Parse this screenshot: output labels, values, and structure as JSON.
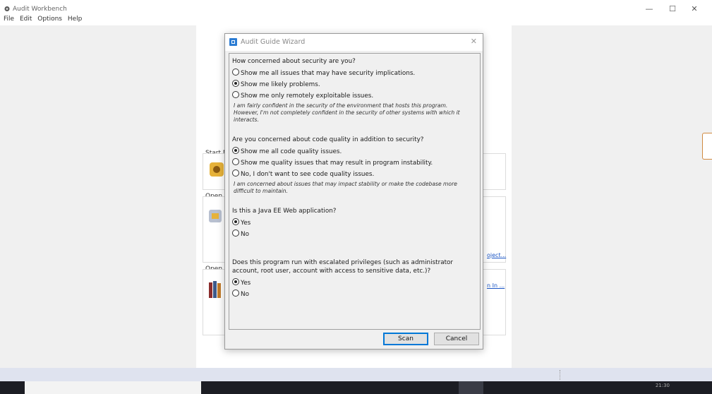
{
  "app": {
    "title": "Audit Workbench"
  },
  "window_controls": {
    "minimize": "—",
    "maximize": "☐",
    "close": "✕"
  },
  "menu": [
    "File",
    "Edit",
    "Options",
    "Help"
  ],
  "background": {
    "start_label": "Start N",
    "open_label_1": "Open",
    "open_label_2": "Open",
    "link_1": "oject...",
    "link_2": "n In ..."
  },
  "dialog": {
    "title": "Audit Guide Wizard",
    "close": "✕",
    "q1": {
      "question": "How concerned about security are you?",
      "options": [
        {
          "label": "Show me all issues that may have security implications.",
          "selected": false
        },
        {
          "label": "Show me likely problems.",
          "selected": true
        },
        {
          "label": "Show me only remotely exploitable issues.",
          "selected": false
        }
      ],
      "description": "I am fairly confident in the security of the environment that hosts this program. However, I'm not completely confident in the security of other systems with which it interacts."
    },
    "q2": {
      "question": "Are you concerned about code quality in addition to security?",
      "options": [
        {
          "label": "Show me all code quality issues.",
          "selected": true
        },
        {
          "label": "Show me quality issues that may result in program instability.",
          "selected": false
        },
        {
          "label": "No, I don't want to see code quality issues.",
          "selected": false
        }
      ],
      "description": "I am concerned about issues that may impact stability or make the codebase more difficult to maintain."
    },
    "q3": {
      "question": "Is this a Java EE Web application?",
      "options": [
        {
          "label": "Yes",
          "selected": true
        },
        {
          "label": "No",
          "selected": false
        }
      ]
    },
    "q4": {
      "question_line1": "Does this program run with escalated privileges (such as administrator",
      "question_line2": "account, root user, account with access to sensitive data, etc.)?",
      "options": [
        {
          "label": "Yes",
          "selected": true
        },
        {
          "label": "No",
          "selected": false
        }
      ]
    },
    "buttons": {
      "scan": "Scan",
      "cancel": "Cancel"
    }
  },
  "taskbar": {
    "clock": "21:30"
  },
  "colors": {
    "accent": "#0078d7",
    "link": "#1a55c5",
    "dialog_bg": "#f0f0f0"
  }
}
